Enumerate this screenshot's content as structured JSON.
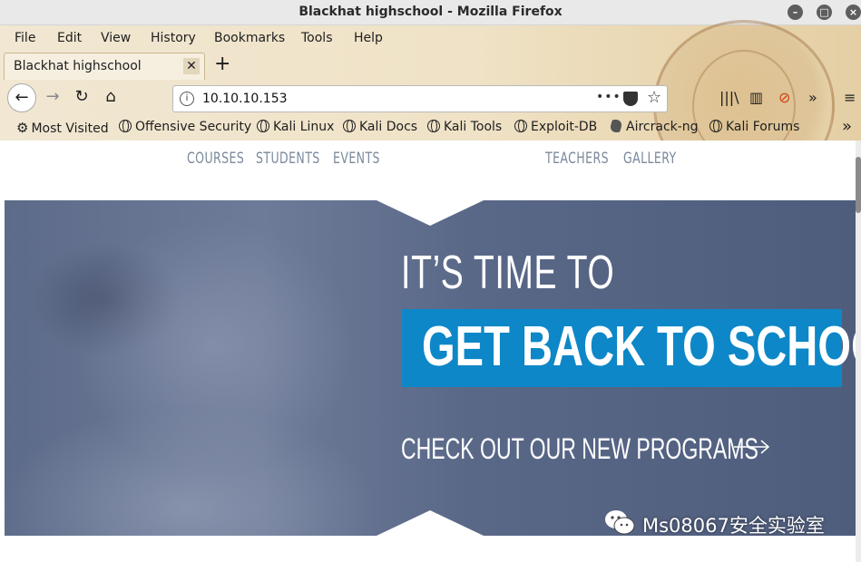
{
  "window": {
    "title": "Blackhat highschool - Mozilla Firefox",
    "controls": [
      "minimize",
      "maximize",
      "close"
    ]
  },
  "menubar": {
    "items": [
      {
        "label": "File"
      },
      {
        "label": "Edit"
      },
      {
        "label": "View"
      },
      {
        "label": "History"
      },
      {
        "label": "Bookmarks"
      },
      {
        "label": "Tools"
      },
      {
        "label": "Help"
      }
    ]
  },
  "tabs": [
    {
      "label": "Blackhat highschool",
      "active": true
    }
  ],
  "toolbar": {
    "url": "10.10.10.153",
    "icons": [
      "back-icon",
      "forward-icon",
      "reload-icon",
      "home-icon",
      "page-actions-icon",
      "pocket-icon",
      "bookmark-star-icon",
      "library-icon",
      "sidebar-icon",
      "addon-icon",
      "overflow-icon",
      "hamburger-menu-icon"
    ]
  },
  "bookmarks": {
    "items": [
      {
        "label": "Most Visited",
        "icon": "gear-icon"
      },
      {
        "label": "Offensive Security",
        "icon": "globe-icon"
      },
      {
        "label": "Kali Linux",
        "icon": "globe-icon"
      },
      {
        "label": "Kali Docs",
        "icon": "globe-icon"
      },
      {
        "label": "Kali Tools",
        "icon": "globe-icon"
      },
      {
        "label": "Exploit-DB",
        "icon": "globe-icon"
      },
      {
        "label": "Aircrack-ng",
        "icon": "leaf-icon"
      },
      {
        "label": "Kali Forums",
        "icon": "globe-icon"
      }
    ]
  },
  "site": {
    "nav": [
      {
        "label": "COURSES"
      },
      {
        "label": "STUDENTS"
      },
      {
        "label": "EVENTS"
      },
      {
        "label": "TEACHERS"
      },
      {
        "label": "GALLERY"
      }
    ],
    "hero": {
      "line1": "IT’S TIME TO",
      "banner": "GET BACK TO SCHOOL",
      "cta": "CHECK OUT OUR NEW PROGRAMS",
      "slides": 3,
      "active_slide": 1
    },
    "colors": {
      "banner": "#0d87c7",
      "nav_text": "#7a8a9c",
      "hero_overlay": "#5a6888"
    }
  },
  "watermark": {
    "text": "Ms08067安全实验室"
  }
}
